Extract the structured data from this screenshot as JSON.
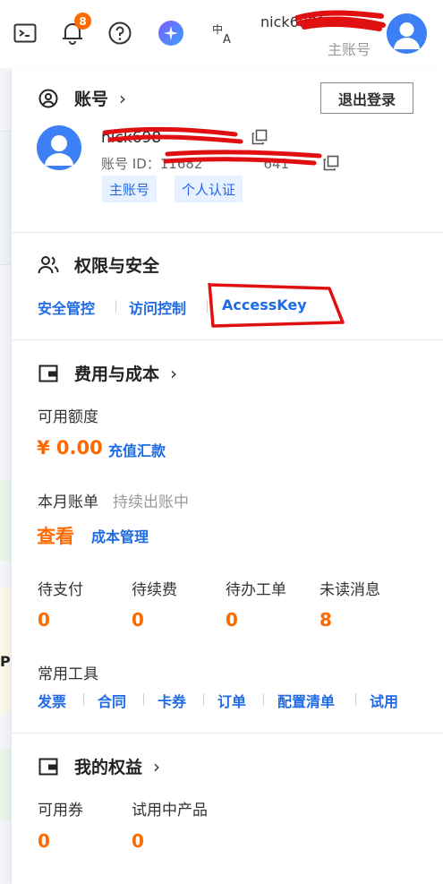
{
  "topbar": {
    "notification_count": "8",
    "user_name": "nick6981",
    "user_role": "主账号",
    "icons": [
      "terminal-icon",
      "bell-icon",
      "help-icon",
      "ai-assistant-icon",
      "language-icon"
    ]
  },
  "background": {
    "partial_text": "P"
  },
  "account": {
    "title": "账号",
    "logout": "退出登录",
    "name": "nick698",
    "id_label": "账号 ID：",
    "id_value": "11682",
    "id_tail": "641",
    "tags": [
      "主账号",
      "个人认证"
    ]
  },
  "security": {
    "title": "权限与安全",
    "links": [
      "安全管控",
      "访问控制",
      "AccessKey"
    ]
  },
  "cost": {
    "title": "费用与成本",
    "available_label": "可用额度",
    "available_amount": "¥ 0.00",
    "recharge": "充值汇款",
    "bill_label": "本月账单",
    "bill_status": "持续出账中",
    "view": "查看",
    "cost_manage": "成本管理",
    "stats": [
      {
        "label": "待支付",
        "value": "0"
      },
      {
        "label": "待续费",
        "value": "0"
      },
      {
        "label": "待办工单",
        "value": "0"
      },
      {
        "label": "未读消息",
        "value": "8"
      }
    ],
    "tools_label": "常用工具",
    "tools": [
      "发票",
      "合同",
      "卡券",
      "订单",
      "配置清单",
      "试用"
    ]
  },
  "benefits": {
    "title": "我的权益",
    "stats": [
      {
        "label": "可用券",
        "value": "0"
      },
      {
        "label": "试用中产品",
        "value": "0"
      }
    ]
  },
  "colors": {
    "accent_blue": "#1f6ae5",
    "accent_orange": "#ff6a00",
    "annotation_red": "#e01010"
  }
}
